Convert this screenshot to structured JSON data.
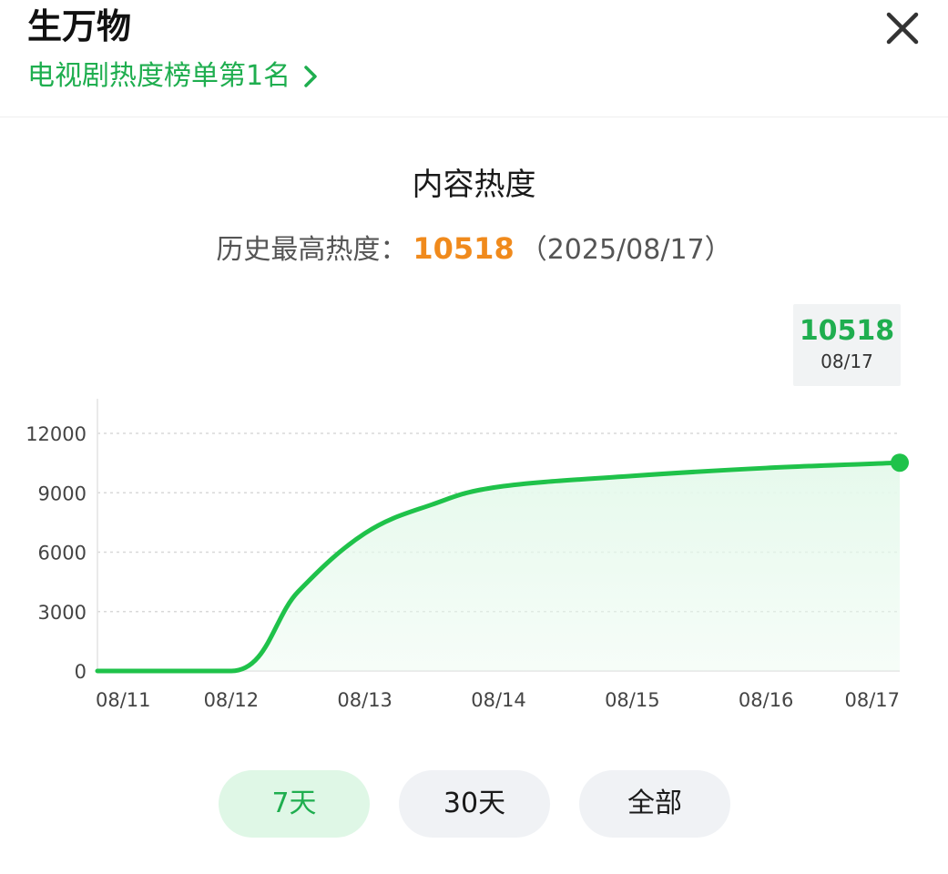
{
  "header": {
    "title": "生万物",
    "rank_link_label": "电视剧热度榜单第1名"
  },
  "summary": {
    "section_title": "内容热度",
    "peak_label": "历史最高热度：",
    "peak_value": "10518",
    "peak_date": "（2025/08/17）"
  },
  "tooltip": {
    "value": "10518",
    "date": "08/17"
  },
  "chart_data": {
    "type": "area",
    "x": [
      "08/11",
      "08/12",
      "08/12.5",
      "08/13",
      "08/13.5",
      "08/14",
      "08/15",
      "08/16",
      "08/17"
    ],
    "categories": [
      "08/11",
      "08/12",
      "08/13",
      "08/14",
      "08/15",
      "08/16",
      "08/17"
    ],
    "series": [
      {
        "values": [
          0,
          0,
          4000,
          6950,
          8400,
          9300,
          9850,
          10250,
          10518
        ]
      }
    ],
    "yticks": [
      "12000",
      "9000",
      "6000",
      "3000",
      "0"
    ],
    "ylim": [
      0,
      12000
    ],
    "grid": true,
    "line_color": "#1fc24a",
    "fill_color": "#e6f9ec",
    "highlight_point": {
      "x": "08/17",
      "value": 10518
    }
  },
  "range_selector": {
    "options": [
      "7天",
      "30天",
      "全部"
    ],
    "selected": "7天"
  },
  "colors": {
    "accent_green": "#1fae4f",
    "peak_orange": "#f08a1c"
  }
}
